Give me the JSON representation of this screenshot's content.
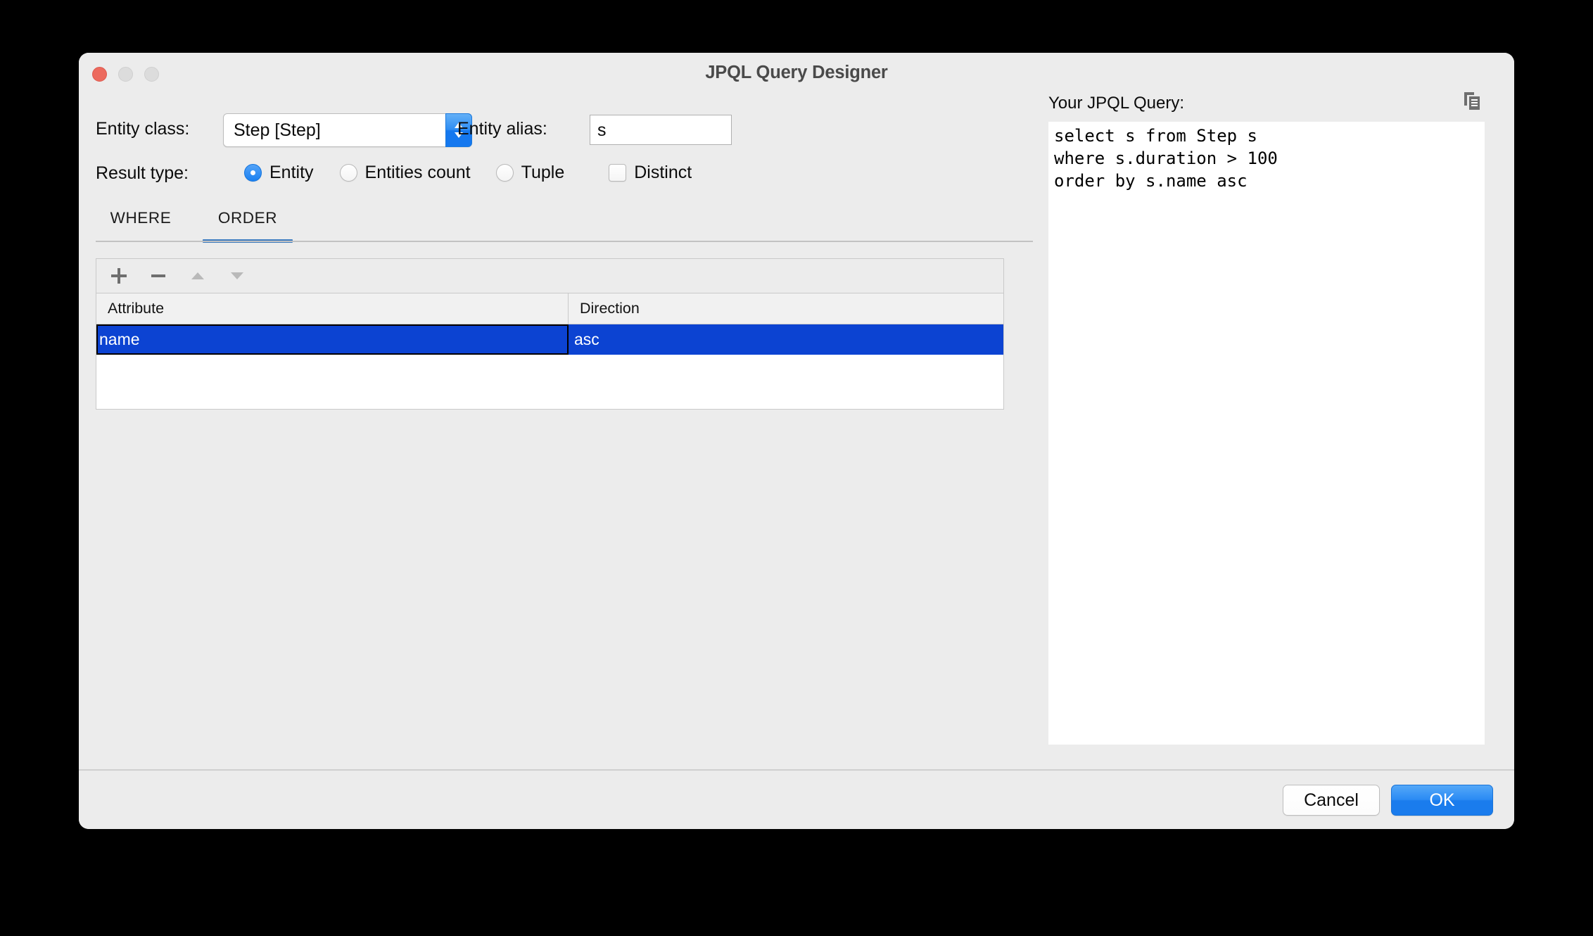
{
  "window": {
    "title": "JPQL Query Designer",
    "traffic_lights": [
      "close-button",
      "minimize-button",
      "maximize-button"
    ]
  },
  "form": {
    "entity_class_label": "Entity class:",
    "entity_class_value": "Step [Step]",
    "entity_alias_label": "Entity alias:",
    "entity_alias_value": "s",
    "entity_alias_placeholder": "",
    "result_type_label": "Result type:",
    "result_types": [
      {
        "label": "Entity",
        "selected": true
      },
      {
        "label": "Entities count",
        "selected": false
      },
      {
        "label": "Tuple",
        "selected": false
      }
    ],
    "distinct_label": "Distinct",
    "distinct_checked": false
  },
  "tabs": [
    {
      "label": "WHERE",
      "active": false
    },
    {
      "label": "ORDER",
      "active": true
    }
  ],
  "toolbar": {
    "add_label": "+",
    "remove_label": "−",
    "move_up_label": "▲",
    "move_down_label": "▼"
  },
  "order_table": {
    "columns": [
      "Attribute",
      "Direction"
    ],
    "rows": [
      {
        "attribute": "name",
        "direction": "asc",
        "selected": true
      }
    ]
  },
  "query": {
    "label": "Your JPQL Query:",
    "text": "select s from Step s\nwhere s.duration > 100\norder by s.name asc",
    "copy_icon": "copy-icon"
  },
  "footer": {
    "cancel_label": "Cancel",
    "ok_label": "OK"
  },
  "colors": {
    "accent_blue": "#1a7ced",
    "tab_underline": "#3e7cc0",
    "selection_blue": "#0c43d2",
    "window_bg": "#ececec",
    "desktop_bg": "#000000"
  }
}
